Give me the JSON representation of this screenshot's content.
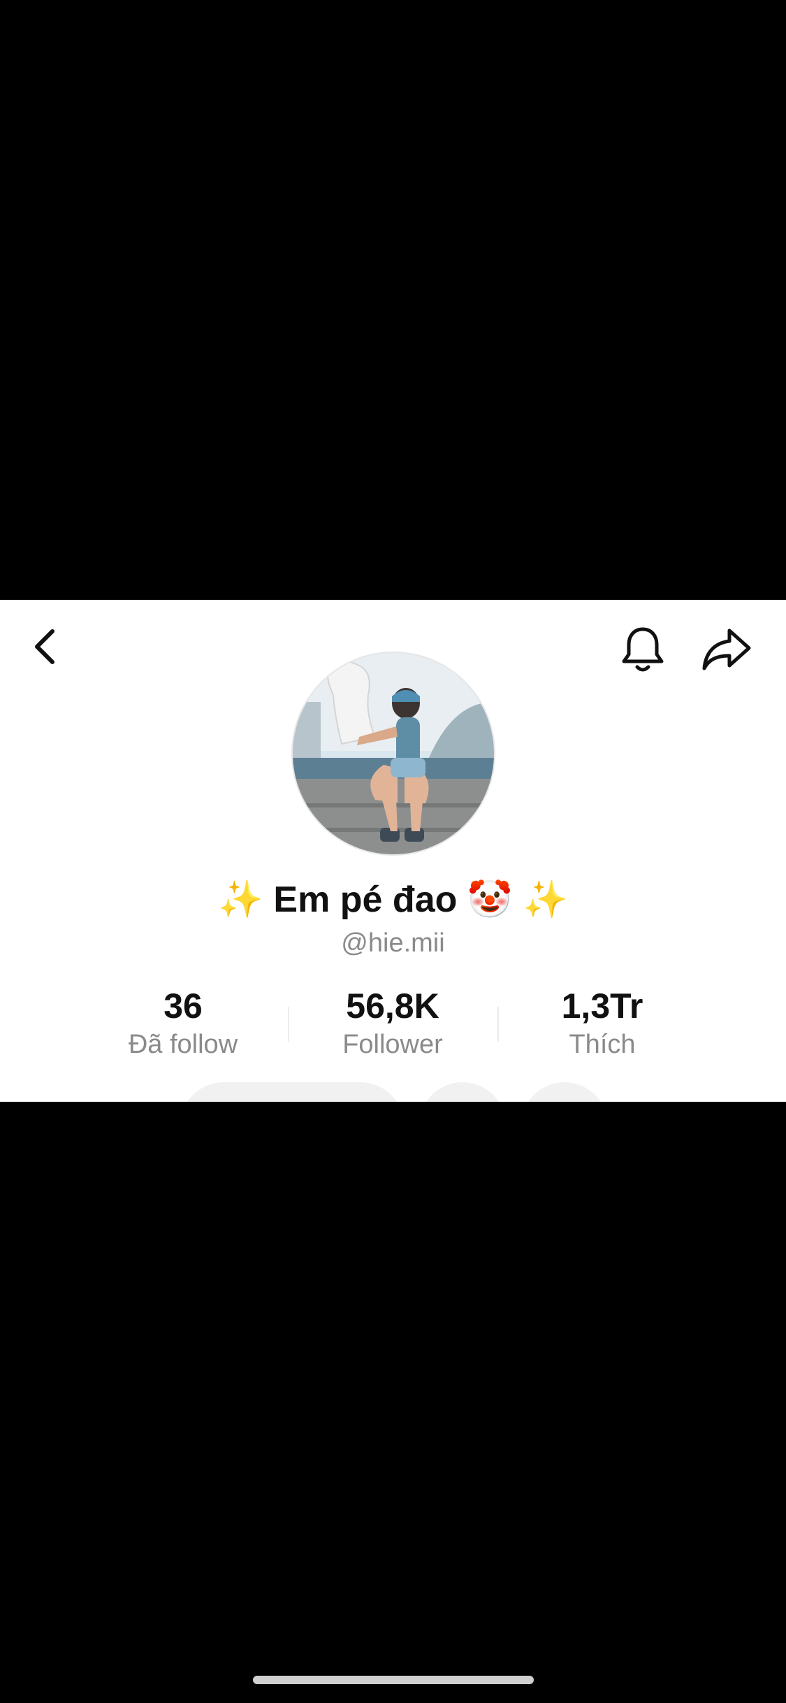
{
  "header": {
    "back_icon": "chevron-left-icon",
    "bell_icon": "bell-icon",
    "share_icon": "share-arrow-icon"
  },
  "profile": {
    "display_name": "✨ Em pé đao 🤡 ✨",
    "handle": "@hie.mii",
    "avatar_description": "profile photo"
  },
  "stats": [
    {
      "value": "36",
      "label": "Đã follow"
    },
    {
      "value": "56,8K",
      "label": "Follower"
    },
    {
      "value": "1,3Tr",
      "label": "Thích"
    }
  ],
  "colors": {
    "background": "#000000",
    "card": "#ffffff",
    "muted_text": "#8a8a8a",
    "primary_text": "#111111"
  }
}
